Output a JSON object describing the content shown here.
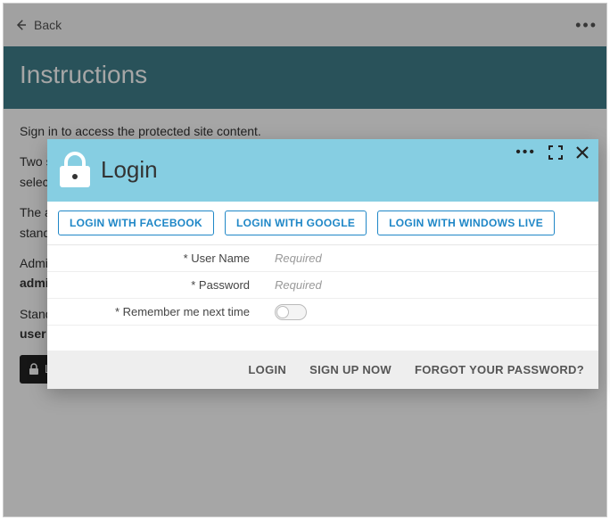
{
  "topbar": {
    "back_label": "Back"
  },
  "page": {
    "title": "Instructions",
    "intro": "Sign in to access the protected site content.",
    "line2": "Two sta",
    "line3": "selecte",
    "line4": "The ad",
    "line5": "standa",
    "line6a": "Admin",
    "line6b": "admin",
    "line7a": "Standa",
    "line7b": "user / "
  },
  "chip": {
    "label": "L"
  },
  "modal": {
    "title": "Login",
    "oauth": {
      "facebook": "LOGIN WITH FACEBOOK",
      "google": "LOGIN WITH GOOGLE",
      "windows": "LOGIN WITH WINDOWS LIVE"
    },
    "fields": {
      "username_label": "* User Name",
      "username_placeholder": "Required",
      "password_label": "* Password",
      "password_placeholder": "Required",
      "remember_label": "* Remember me next time"
    },
    "footer": {
      "login": "LOGIN",
      "signup": "SIGN UP NOW",
      "forgot": "FORGOT YOUR PASSWORD?"
    }
  }
}
